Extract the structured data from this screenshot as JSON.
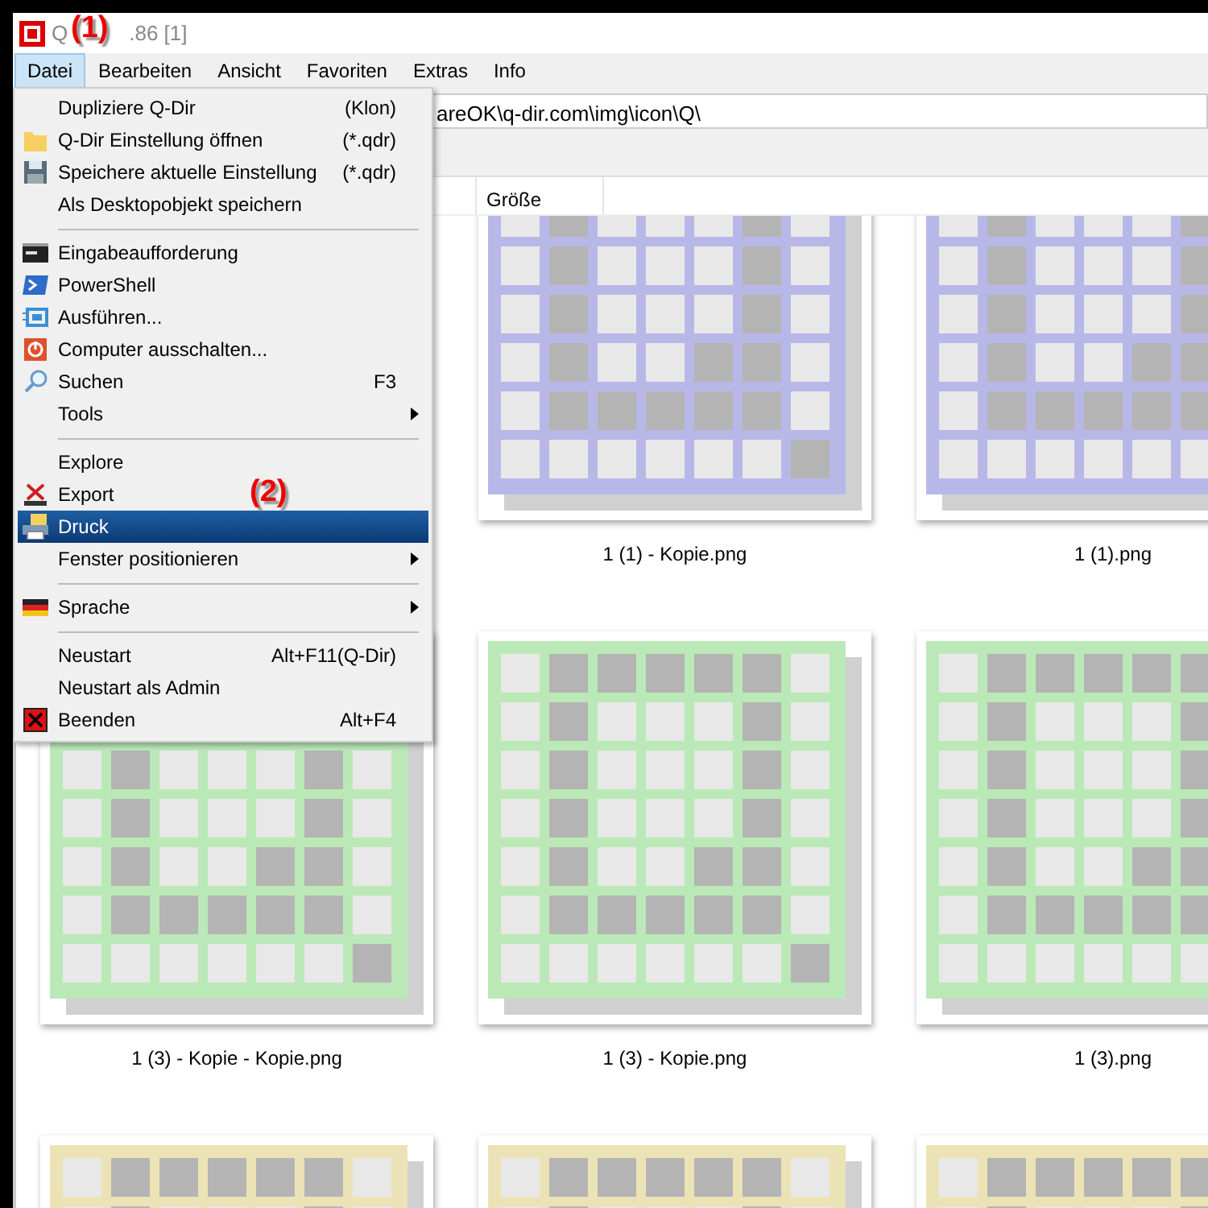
{
  "window": {
    "title_start": "Q",
    "title_end": ".86 [1]"
  },
  "annotations": [
    {
      "text": "(1)"
    },
    {
      "text": "(2)"
    }
  ],
  "menu_bar": [
    {
      "label": "Datei",
      "selected": true
    },
    {
      "label": "Bearbeiten",
      "selected": false
    },
    {
      "label": "Ansicht",
      "selected": false
    },
    {
      "label": "Favoriten",
      "selected": false
    },
    {
      "label": "Extras",
      "selected": false
    },
    {
      "label": "Info",
      "selected": false
    }
  ],
  "menu": [
    {
      "kind": "item",
      "label": "Dupliziere Q-Dir",
      "shortcut": "(Klon)",
      "selected": false
    },
    {
      "kind": "item",
      "label": "Q-Dir Einstellung öffnen",
      "shortcut": "(*.qdr)",
      "selected": false
    },
    {
      "kind": "item",
      "label": "Speichere  aktuelle Einstellung",
      "shortcut": "(*.qdr)",
      "selected": false
    },
    {
      "kind": "item",
      "label": "Als Desktopobjekt speichern",
      "selected": false
    },
    {
      "kind": "separator"
    },
    {
      "kind": "item",
      "label": "Eingabeaufforderung",
      "selected": false
    },
    {
      "kind": "item",
      "label": "PowerShell",
      "selected": false
    },
    {
      "kind": "item",
      "label": "Ausführen...",
      "selected": false
    },
    {
      "kind": "item",
      "label": "Computer ausschalten...",
      "selected": false
    },
    {
      "kind": "item",
      "label": "Suchen",
      "shortcut": "F3",
      "selected": false
    },
    {
      "kind": "submenu",
      "label": "Tools",
      "selected": false
    },
    {
      "kind": "separator"
    },
    {
      "kind": "item",
      "label": "Explore",
      "selected": false
    },
    {
      "kind": "item",
      "label": "Export",
      "selected": false
    },
    {
      "kind": "item",
      "label": "Druck",
      "selected": true
    },
    {
      "kind": "submenu",
      "label": "Fenster positionieren",
      "selected": false
    },
    {
      "kind": "separator"
    },
    {
      "kind": "submenu",
      "label": "Sprache",
      "selected": false
    },
    {
      "kind": "separator"
    },
    {
      "kind": "item",
      "label": "Neustart",
      "shortcut": "Alt+F11(Q-Dir)",
      "selected": false
    },
    {
      "kind": "item",
      "label": "Neustart als Admin",
      "selected": false
    },
    {
      "kind": "item",
      "label": "Beenden",
      "shortcut": "Alt+F4",
      "selected": false
    }
  ],
  "address_bar": {
    "value": "areOK\\q-dir.com\\img\\icon\\Q\\"
  },
  "columns": [
    "Größe"
  ],
  "thumbnails": [
    [
      {
        "color": "#b8b8e8",
        "name": "1 (1) - Kopie.png"
      },
      {
        "color": "#b8b8e8",
        "name": "1 (1).png"
      }
    ],
    [
      {
        "color": "#bae9b7",
        "name": "1 (3) - Kopie - Kopie.png"
      },
      {
        "color": "#bae9b7",
        "name": "1 (3) - Kopie.png"
      },
      {
        "color": "#bae9b7",
        "name": "1 (3).png"
      }
    ],
    [
      {
        "color": "#ebe3b6"
      },
      {
        "color": "#ebe3b6"
      },
      {
        "color": "#ebe3b6"
      }
    ]
  ]
}
